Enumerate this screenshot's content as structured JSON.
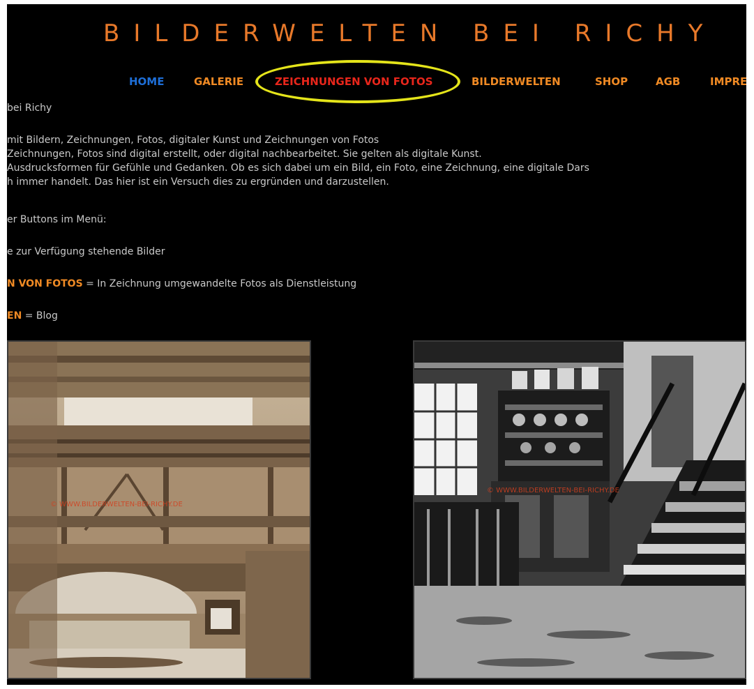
{
  "header": {
    "site_title": "BILDERWELTEN BEI RICHY"
  },
  "nav": {
    "items": [
      {
        "label": "HOME",
        "color": "#1e6fd8"
      },
      {
        "label": "GALERIE",
        "color": "#f08a24"
      },
      {
        "label": "ZEICHNUNGEN VON FOTOS",
        "color": "#e8261b"
      },
      {
        "label": "BILDERWELTEN",
        "color": "#f08a24"
      },
      {
        "label": "SHOP",
        "color": "#f08a24"
      },
      {
        "label": "AGB",
        "color": "#f08a24"
      },
      {
        "label": "IMPRE",
        "color": "#f08a24"
      }
    ],
    "highlight_color": "#e4e41a"
  },
  "content": {
    "line1": "bei Richy",
    "line2": "mit Bildern, Zeichnungen, Fotos, digitaler Kunst und Zeichnungen von Fotos",
    "line3": "Zeichnungen, Fotos sind digital erstellt, oder digital nachbearbeitet. Sie gelten als digitale Kunst.",
    "line4": "Ausdrucksformen für Gefühle und Gedanken. Ob es sich dabei um ein Bild, ein Foto, eine Zeichnung, eine digitale Dars",
    "line5": "h immer handelt. Das hier ist ein Versuch dies zu ergründen und darzustellen.",
    "line6": "er Buttons im Menü:",
    "line7": "e zur Verfügung stehende Bilder",
    "line8_highlight": "N VON FOTOS",
    "line8_rest": " = In Zeichnung umgewandelte Fotos als Dienstleistung",
    "line9_highlight": "EN",
    "line9_rest": " = Blog"
  },
  "images": {
    "left": {
      "icon": "industrial-bridge-photo",
      "watermark": "© WWW.BILDERWELTEN-BEI-RICHY.DE"
    },
    "right": {
      "icon": "old-kitchen-staircase-photo",
      "watermark": "© WWW.BILDERWELTEN-BEI-RICHY.DE"
    }
  },
  "colors": {
    "background": "#000000",
    "accent": "#f08a24",
    "title": "#e8792a",
    "text": "#c9c9c9"
  }
}
